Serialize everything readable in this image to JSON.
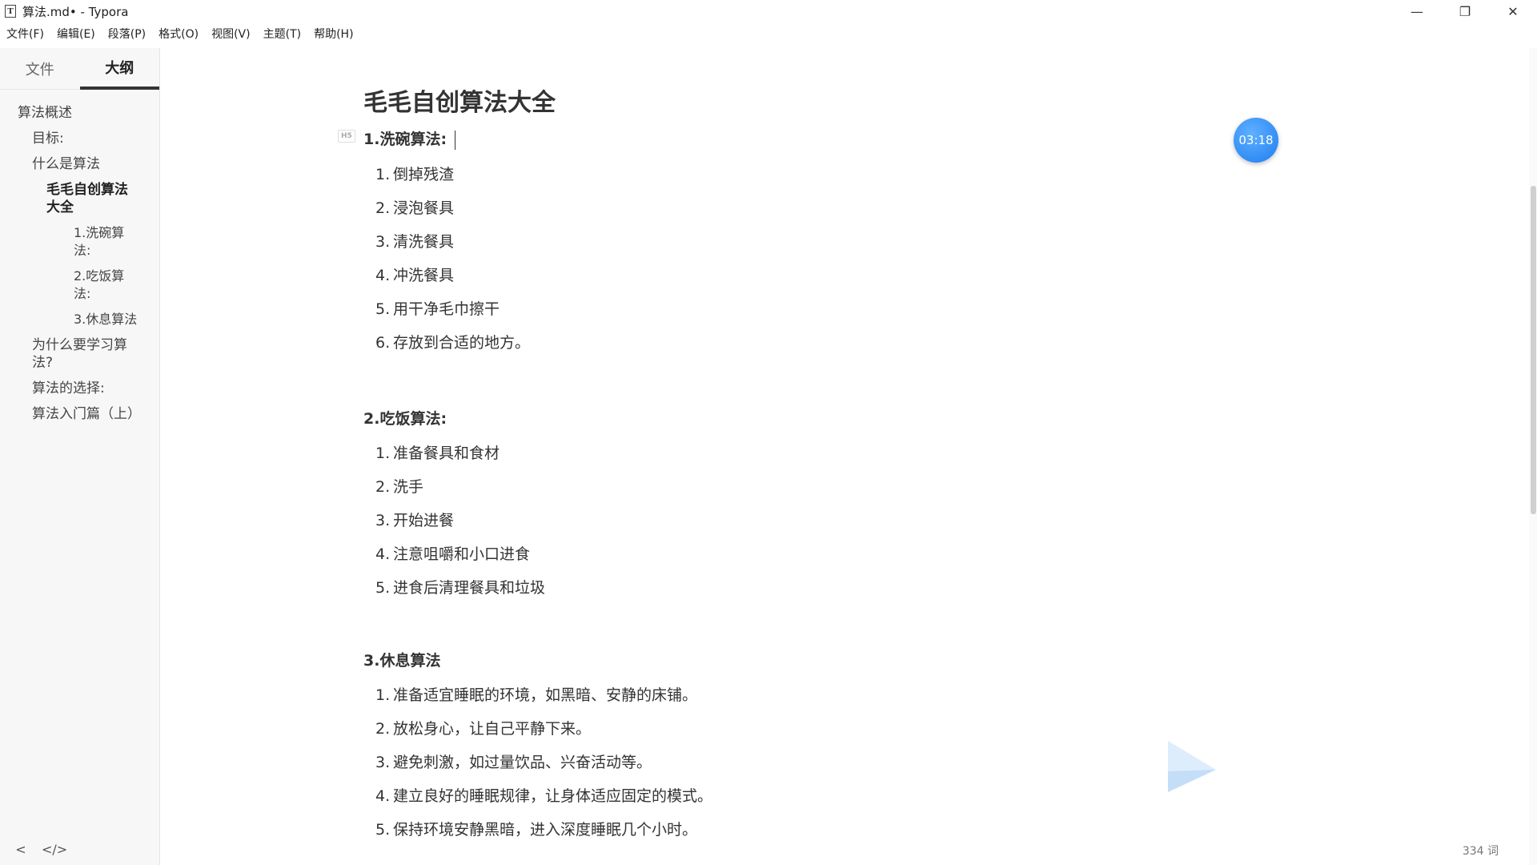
{
  "window": {
    "app_icon": "T",
    "title": "算法.md• - Typora",
    "controls": {
      "minimize": "—",
      "maximize": "❐",
      "close": "✕"
    }
  },
  "menu": [
    "文件(F)",
    "编辑(E)",
    "段落(P)",
    "格式(O)",
    "视图(V)",
    "主题(T)",
    "帮助(H)"
  ],
  "sidebar": {
    "tabs": [
      {
        "label": "文件",
        "active": false
      },
      {
        "label": "大纲",
        "active": true
      }
    ],
    "outline": [
      {
        "label": "算法概述",
        "level": 1
      },
      {
        "label": "目标:",
        "level": 2
      },
      {
        "label": "什么是算法",
        "level": 2
      },
      {
        "label": "毛毛自创算法大全",
        "level": 3
      },
      {
        "label": "1.洗碗算法:",
        "level": 4
      },
      {
        "label": "2.吃饭算法:",
        "level": 4
      },
      {
        "label": "3.休息算法",
        "level": 4
      },
      {
        "label": "为什么要学习算法?",
        "level": 2
      },
      {
        "label": "算法的选择:",
        "level": 2
      },
      {
        "label": "算法入门篇（上）",
        "level": 2
      }
    ],
    "footer": {
      "back": "<",
      "source": "</>"
    }
  },
  "document": {
    "title": "毛毛自创算法大全",
    "h5_badge": "H5",
    "sections": [
      {
        "heading": "1.洗碗算法:",
        "items": [
          "倒掉残渣",
          "浸泡餐具",
          "清洗餐具",
          "冲洗餐具",
          "用干净毛巾擦干",
          "存放到合适的地方。"
        ]
      },
      {
        "heading": "2.吃饭算法:",
        "items": [
          "准备餐具和食材",
          "洗手",
          "开始进餐",
          "注意咀嚼和小口进食",
          "进食后清理餐具和垃圾"
        ]
      },
      {
        "heading": "3.休息算法",
        "items": [
          "准备适宜睡眠的环境，如黑暗、安静的床铺。",
          "放松身心，让自己平静下来。",
          "避免刺激，如过量饮品、兴奋活动等。",
          "建立良好的睡眠规律，让身体适应固定的模式。",
          "保持环境安静黑暗，进入深度睡眠几个小时。"
        ]
      }
    ]
  },
  "overlay": {
    "timer": "03:18"
  },
  "status": {
    "word_count": "334 词"
  }
}
